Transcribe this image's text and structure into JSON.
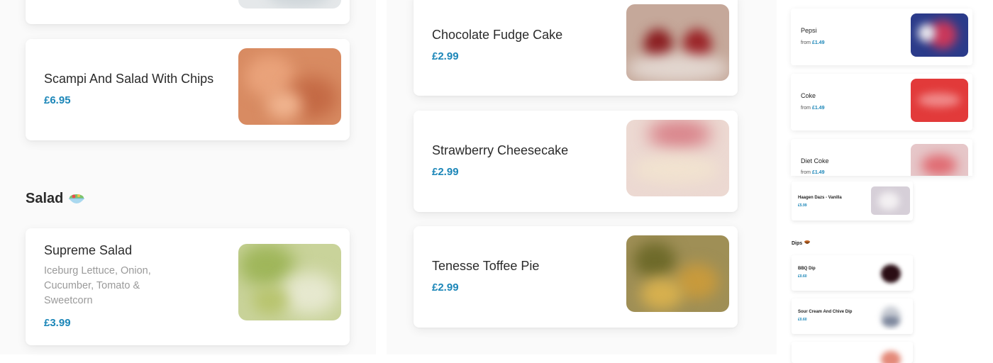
{
  "left_column": {
    "cards": [
      {
        "name": "",
        "price": "",
        "image": "partial-food-image"
      },
      {
        "name": "Scampi And Salad With Chips",
        "price": "£6.95",
        "image": "scampi-image"
      }
    ],
    "section": {
      "title": "Salad",
      "icon": "salad-bowl-icon"
    },
    "salad_cards": [
      {
        "name": "Supreme Salad",
        "description": "Iceburg Lettuce, Onion, Cucumber, Tomato & Sweetcorn",
        "price": "£3.99",
        "image": "salad-image"
      }
    ]
  },
  "middle_column": {
    "cards": [
      {
        "name": "Chocolate Fudge Cake",
        "price": "£2.99",
        "image": "fudge-cake-image"
      },
      {
        "name": "Strawberry Cheesecake",
        "price": "£2.99",
        "image": "cheesecake-image"
      },
      {
        "name": "Tenesse Toffee Pie",
        "price": "£2.99",
        "image": "toffee-pie-image"
      }
    ]
  },
  "right_column": {
    "drinks": [
      {
        "name": "Pepsi",
        "from": "from",
        "price": "£1.49",
        "image": "pepsi-image"
      },
      {
        "name": "Coke",
        "from": "from",
        "price": "£1.49",
        "image": "coke-image"
      },
      {
        "name": "Diet Coke",
        "from": "from",
        "price": "£1.49",
        "image": "diet-coke-image"
      }
    ],
    "thumbnail_cards": [
      {
        "name": "Haagen Dazs - Vanilla",
        "price": "£5.99"
      }
    ],
    "dips_section": {
      "title": "Dips",
      "icon": "dip-bowl-icon"
    },
    "dips": [
      {
        "name": "BBQ Dip",
        "price": "£0.60"
      },
      {
        "name": "Sour Cream And Chive Dip",
        "price": "£0.60"
      }
    ]
  },
  "colors": {
    "price": "#1b86b8",
    "text": "#2b2b2b",
    "muted": "#9a9a9a"
  }
}
